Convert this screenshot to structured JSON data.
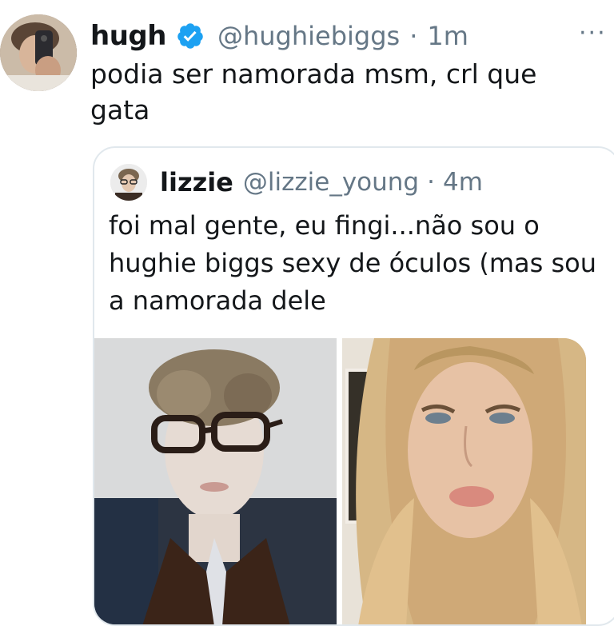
{
  "tweet": {
    "author_name": "hugh",
    "author_handle": "@hughiebiggs",
    "separator": "·",
    "time": "1m",
    "more_label": "···",
    "text": "podia ser namorada msm, crl que gata",
    "avatar_icon": "profile-photo",
    "verified_icon": "verified-badge-icon",
    "verified_color": "#1da1f2"
  },
  "quoted_tweet": {
    "author_name": "lizzie",
    "author_handle": "@lizzie_young",
    "separator": "·",
    "time": "4m",
    "text": "foi mal gente, eu fingi...não sou o hughie biggs sexy de óculos (mas sou a namorada dele",
    "media": [
      {
        "name": "photo-man-glasses"
      },
      {
        "name": "photo-blonde-woman"
      }
    ]
  },
  "colors": {
    "text": "#14171a",
    "secondary": "#657786",
    "border": "#e1e8ed"
  }
}
